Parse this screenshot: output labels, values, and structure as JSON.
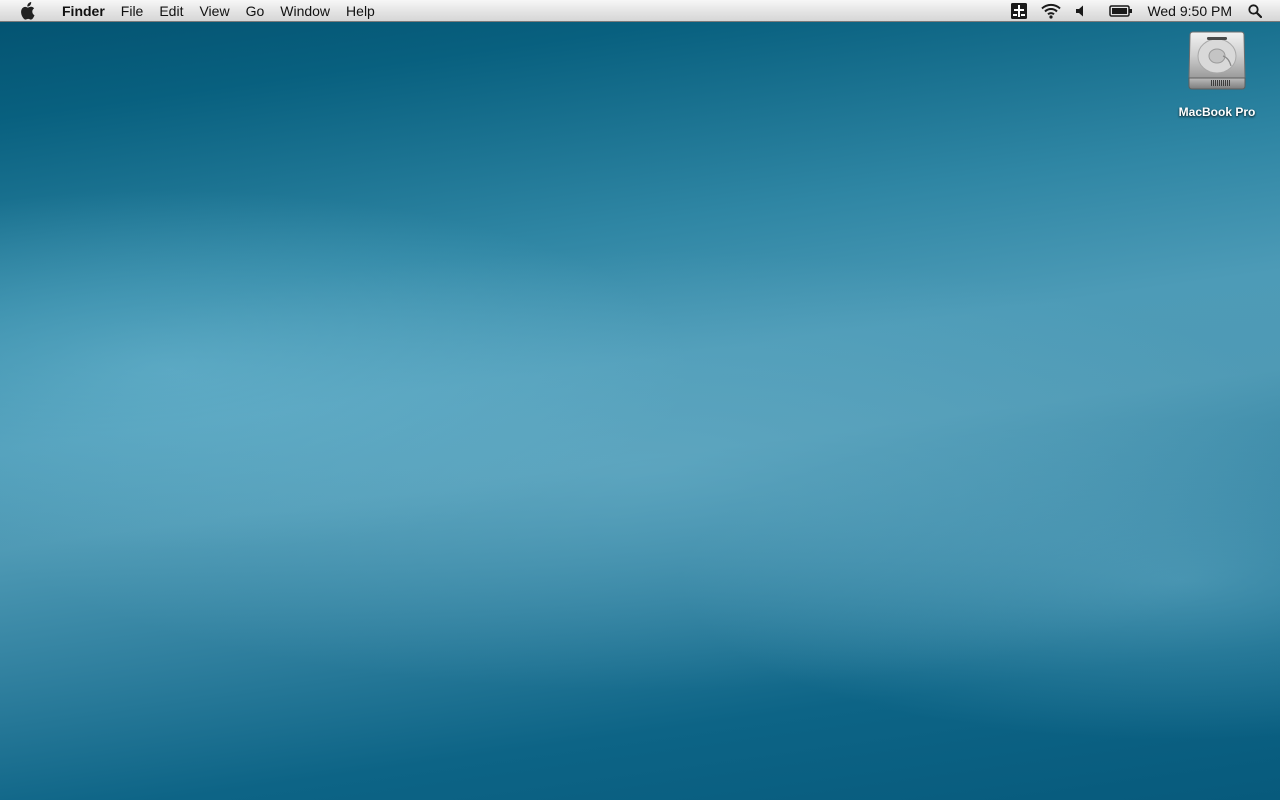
{
  "menubar": {
    "apple_menu": "apple-icon",
    "app_name": "Finder",
    "menus": [
      "File",
      "Edit",
      "View",
      "Go",
      "Window",
      "Help"
    ],
    "status_icons": [
      "keyboard-input-icon",
      "wifi-icon",
      "volume-icon",
      "battery-icon"
    ],
    "clock": "Wed 9:50 PM",
    "spotlight": "search-icon"
  },
  "desktop": {
    "icons": [
      {
        "label": "MacBook Pro",
        "icon": "hard-drive-icon"
      }
    ],
    "wallpaper_colors": [
      "#03516f",
      "#4d9bb7",
      "#075a7c"
    ]
  }
}
